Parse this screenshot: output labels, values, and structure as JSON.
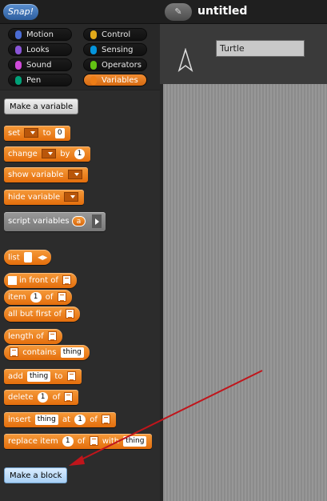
{
  "app": {
    "logo_text": "Snap!",
    "project_button_glyph": "✎",
    "project_title": "untitled"
  },
  "categories": [
    {
      "label": "Motion",
      "color": "#4a6cd4"
    },
    {
      "label": "Control",
      "color": "#e1a91a"
    },
    {
      "label": "Looks",
      "color": "#8a55d7"
    },
    {
      "label": "Sensing",
      "color": "#0494dc"
    },
    {
      "label": "Sound",
      "color": "#cf4ad9"
    },
    {
      "label": "Operators",
      "color": "#62c213"
    },
    {
      "label": "Pen",
      "color": "#00a178"
    },
    {
      "label": "Variables",
      "color": "#ee7d16"
    }
  ],
  "palette": {
    "make_variable": "Make a variable",
    "set": {
      "label": "set",
      "to": "to",
      "value": "0"
    },
    "change": {
      "label": "change",
      "by": "by",
      "value": "1"
    },
    "show_variable": "show variable",
    "hide_variable": "hide variable",
    "script_variables": {
      "label": "script variables",
      "var": "a"
    },
    "list": "list",
    "in_front_of": "in front of",
    "item": {
      "label": "item",
      "index": "1",
      "of": "of"
    },
    "all_but_first": "all but first of",
    "length_of": "length of",
    "contains": {
      "label": "contains",
      "value": "thing"
    },
    "add": {
      "label": "add",
      "value": "thing",
      "to": "to"
    },
    "delete": {
      "label": "delete",
      "index": "1",
      "of": "of"
    },
    "insert": {
      "label": "insert",
      "value": "thing",
      "at": "at",
      "index": "1",
      "of": "of"
    },
    "replace": {
      "label": "replace item",
      "index": "1",
      "of": "of",
      "with": "with",
      "value": "thing"
    },
    "make_block": "Make a block"
  },
  "sprite": {
    "name": "Turtle"
  },
  "annotation": {
    "arrow_color": "#c0151b"
  }
}
